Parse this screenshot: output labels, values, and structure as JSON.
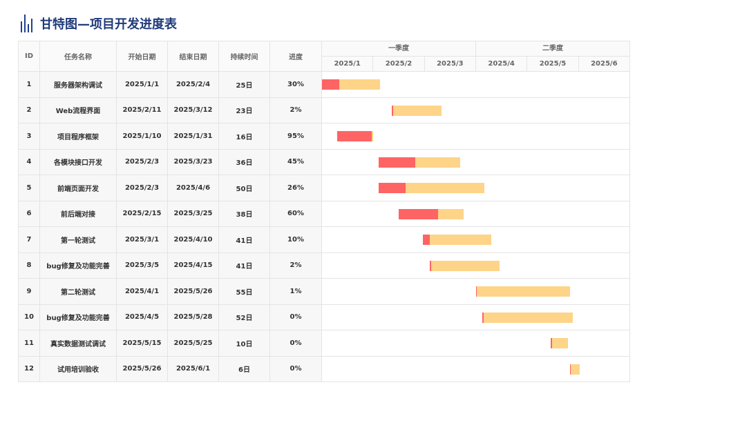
{
  "title": "甘特图—项目开发进度表",
  "header": {
    "id": "ID",
    "name": "任务名称",
    "start": "开始日期",
    "end": "结束日期",
    "duration": "持续时间",
    "progress": "进度",
    "quarters": [
      "一季度",
      "二季度"
    ],
    "months": [
      "2025/1",
      "2025/2",
      "2025/3",
      "2025/4",
      "2025/5",
      "2025/6"
    ]
  },
  "colors": {
    "bar": "#fdd488",
    "progress": "#fe6464",
    "title": "#1f3a7a"
  },
  "tasks": [
    {
      "id": "1",
      "name": "服务器架构调试",
      "start": "2025/1/1",
      "end": "2025/2/4",
      "duration": "25日",
      "progress": "30%"
    },
    {
      "id": "2",
      "name": "Web流程界面",
      "start": "2025/2/11",
      "end": "2025/3/12",
      "duration": "23日",
      "progress": "2%"
    },
    {
      "id": "3",
      "name": "项目程序框架",
      "start": "2025/1/10",
      "end": "2025/1/31",
      "duration": "16日",
      "progress": "95%"
    },
    {
      "id": "4",
      "name": "各模块接口开发",
      "start": "2025/2/3",
      "end": "2025/3/23",
      "duration": "36日",
      "progress": "45%"
    },
    {
      "id": "5",
      "name": "前端页面开发",
      "start": "2025/2/3",
      "end": "2025/4/6",
      "duration": "50日",
      "progress": "26%"
    },
    {
      "id": "6",
      "name": "前后端对接",
      "start": "2025/2/15",
      "end": "2025/3/25",
      "duration": "38日",
      "progress": "60%"
    },
    {
      "id": "7",
      "name": "第一轮测试",
      "start": "2025/3/1",
      "end": "2025/4/10",
      "duration": "41日",
      "progress": "10%"
    },
    {
      "id": "8",
      "name": "bug修复及功能完善",
      "start": "2025/3/5",
      "end": "2025/4/15",
      "duration": "41日",
      "progress": "2%"
    },
    {
      "id": "9",
      "name": "第二轮测试",
      "start": "2025/4/1",
      "end": "2025/5/26",
      "duration": "55日",
      "progress": "1%"
    },
    {
      "id": "10",
      "name": "bug修复及功能完善",
      "start": "2025/4/5",
      "end": "2025/5/28",
      "duration": "52日",
      "progress": "0%"
    },
    {
      "id": "11",
      "name": "真实数据测试调试",
      "start": "2025/5/15",
      "end": "2025/5/25",
      "duration": "10日",
      "progress": "0%"
    },
    {
      "id": "12",
      "name": "试用培训验收",
      "start": "2025/5/26",
      "end": "2025/6/1",
      "duration": "6日",
      "progress": "0%"
    }
  ],
  "chart_data": {
    "type": "bar",
    "categories": [
      "服务器架构调试",
      "Web流程界面",
      "项目程序框架",
      "各模块接口开发",
      "前端页面开发",
      "前后端对接",
      "第一轮测试",
      "bug修复及功能完善",
      "第二轮测试",
      "bug修复及功能完善",
      "真实数据测试调试",
      "试用培训验收"
    ],
    "start": [
      "2025/1/1",
      "2025/2/11",
      "2025/1/10",
      "2025/2/3",
      "2025/2/3",
      "2025/2/15",
      "2025/3/1",
      "2025/3/5",
      "2025/4/1",
      "2025/4/5",
      "2025/5/15",
      "2025/5/26"
    ],
    "end": [
      "2025/2/4",
      "2025/3/12",
      "2025/1/31",
      "2025/3/23",
      "2025/4/6",
      "2025/3/25",
      "2025/4/10",
      "2025/4/15",
      "2025/5/26",
      "2025/5/28",
      "2025/5/25",
      "2025/6/1"
    ],
    "progress": [
      0.3,
      0.02,
      0.95,
      0.45,
      0.26,
      0.6,
      0.1,
      0.02,
      0.01,
      0.0,
      0.0,
      0.0
    ],
    "xlim": [
      "2025/1/1",
      "2025/6/30"
    ]
  }
}
